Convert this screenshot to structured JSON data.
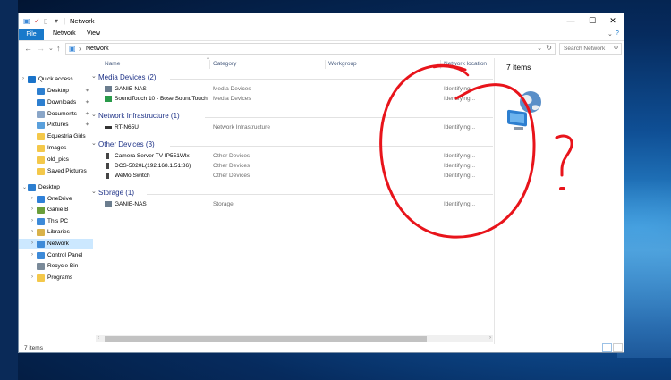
{
  "window": {
    "title": "Network",
    "controls": {
      "minimize": "—",
      "maximize": "☐",
      "close": "✕"
    }
  },
  "ribbon": {
    "tabs": [
      {
        "label": "File"
      },
      {
        "label": "Network"
      },
      {
        "label": "View"
      }
    ],
    "help": "?"
  },
  "address": {
    "back": "←",
    "forward": "→",
    "recent": "⌄",
    "up": "↑",
    "path_separator": "›",
    "path": "Network",
    "search_placeholder": "Search Network"
  },
  "sidebar": {
    "items": [
      {
        "label": "Quick access",
        "icon": "star-icon",
        "color": "#1a73c9"
      },
      {
        "label": "Desktop",
        "icon": "folder-icon",
        "color": "#2d7fd0",
        "pinned": true
      },
      {
        "label": "Downloads",
        "icon": "download-icon",
        "color": "#2d7fd0",
        "pinned": true
      },
      {
        "label": "Documents",
        "icon": "documents-icon",
        "color": "#8aa6c8",
        "pinned": true
      },
      {
        "label": "Pictures",
        "icon": "pictures-icon",
        "color": "#5aa0dc",
        "pinned": true
      },
      {
        "label": "Equestria Girls",
        "icon": "folder-icon",
        "color": "#f4c84a"
      },
      {
        "label": "Images",
        "icon": "folder-icon",
        "color": "#f4c84a"
      },
      {
        "label": "old_pics",
        "icon": "folder-icon",
        "color": "#f4c84a"
      },
      {
        "label": "Saved Pictures",
        "icon": "folder-icon",
        "color": "#f4c84a"
      },
      {
        "label": "Desktop",
        "icon": "desktop-icon",
        "color": "#2d7fd0"
      },
      {
        "label": "OneDrive",
        "icon": "cloud-icon",
        "color": "#2f80d8"
      },
      {
        "label": "Ganie B",
        "icon": "user-icon",
        "color": "#6a9e3a"
      },
      {
        "label": "This PC",
        "icon": "computer-icon",
        "color": "#3d8ad8"
      },
      {
        "label": "Libraries",
        "icon": "libraries-icon",
        "color": "#d9b24a"
      },
      {
        "label": "Network",
        "icon": "network-icon",
        "color": "#3d8ad8",
        "selected": true
      },
      {
        "label": "Control Panel",
        "icon": "control-panel-icon",
        "color": "#3d8ad8"
      },
      {
        "label": "Recycle Bin",
        "icon": "recycle-bin-icon",
        "color": "#7a8a99"
      },
      {
        "label": "Programs",
        "icon": "folder-icon",
        "color": "#f4c84a"
      }
    ]
  },
  "columns": {
    "name": "Name",
    "category": "Category",
    "workgroup": "Workgroup",
    "network_location": "Network location",
    "sort_indicator": "^"
  },
  "groups": [
    {
      "title": "Media Devices (2)",
      "items": [
        {
          "name": "GANIE-NAS",
          "category": "Media Devices",
          "location": "Identifying...",
          "icon": "media-device-icon"
        },
        {
          "name": "SoundTouch 10 - Bose SoundTouch",
          "category": "Media Devices",
          "location": "Identifying...",
          "icon": "speaker-icon"
        }
      ]
    },
    {
      "title": "Network Infrastructure (1)",
      "items": [
        {
          "name": "RT-N65U",
          "category": "Network Infrastructure",
          "location": "Identifying...",
          "icon": "router-icon"
        }
      ]
    },
    {
      "title": "Other Devices (3)",
      "items": [
        {
          "name": "Camera Server TV-IP551Wlx",
          "category": "Other Devices",
          "location": "Identifying...",
          "icon": "device-icon"
        },
        {
          "name": "DCS-5020L(192.168.1.51:86)",
          "category": "Other Devices",
          "location": "Identifying...",
          "icon": "device-icon"
        },
        {
          "name": "WeMo Switch",
          "category": "Other Devices",
          "location": "Identifying...",
          "icon": "device-icon"
        }
      ]
    },
    {
      "title": "Storage (1)",
      "items": [
        {
          "name": "GANIE-NAS",
          "category": "Storage",
          "location": "Identifying...",
          "icon": "storage-icon"
        }
      ]
    }
  ],
  "preview": {
    "count": "7 items",
    "icon": "network-globe-icon"
  },
  "status": {
    "count": "7 items"
  },
  "annotation": {
    "mark": "?",
    "color": "#e8141b"
  }
}
